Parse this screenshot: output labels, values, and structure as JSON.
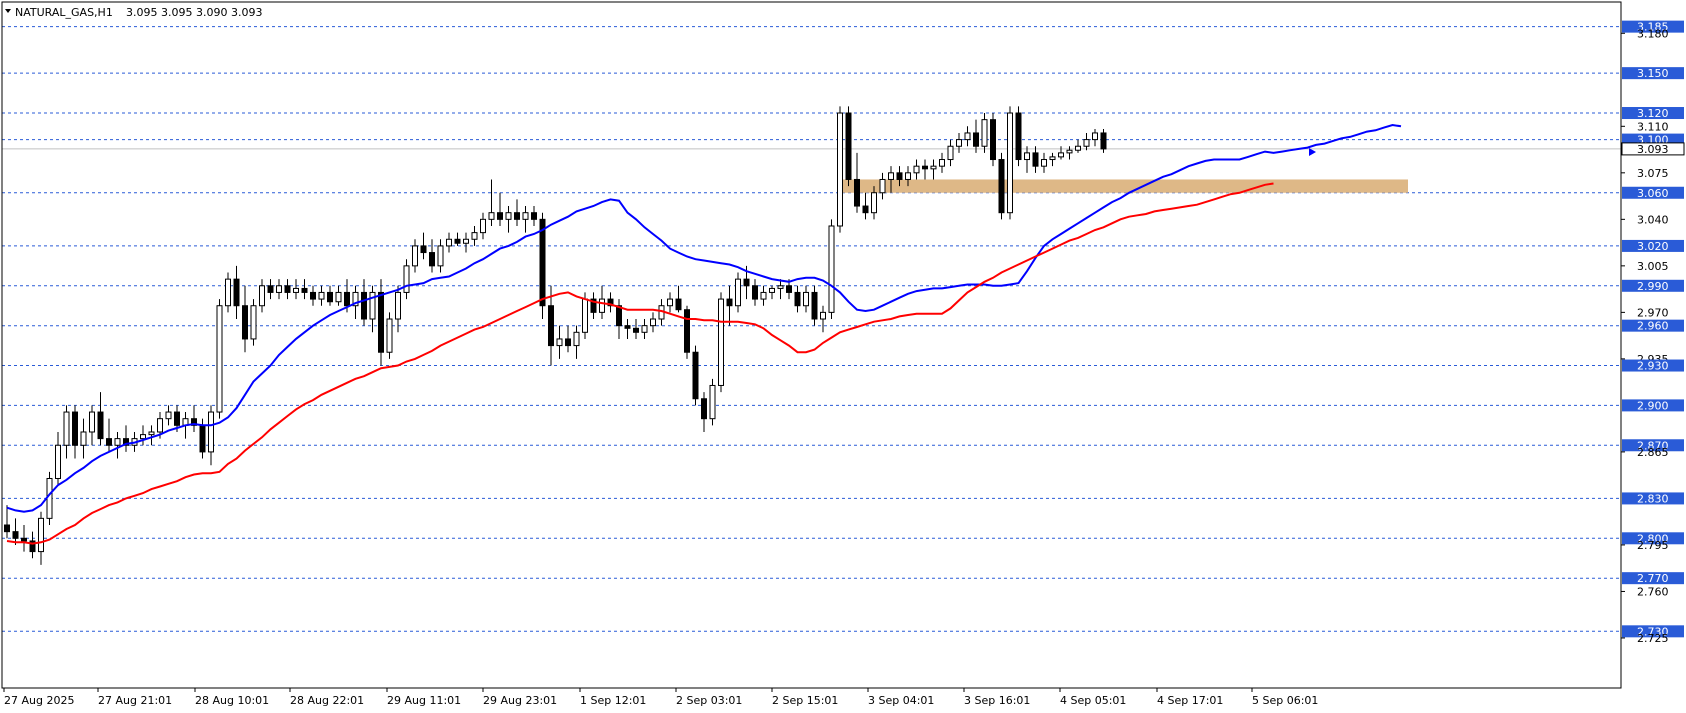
{
  "header": {
    "symbol": "NATURAL_GAS,H1",
    "ohlc": "3.095 3.095 3.090 3.093"
  },
  "chart_data": {
    "type": "candlestick",
    "title": "NATURAL_GAS,H1",
    "ylim": [
      2.715,
      3.195
    ],
    "grid": false,
    "y_ticks": [
      "3.185",
      "3.180",
      "3.150",
      "3.120",
      "3.110",
      "3.100",
      "3.093",
      "3.075",
      "3.060",
      "3.040",
      "3.020",
      "3.005",
      "2.990",
      "2.970",
      "2.960",
      "2.935",
      "2.930",
      "2.900",
      "2.870",
      "2.865",
      "2.830",
      "2.800",
      "2.795",
      "2.770",
      "2.760",
      "2.730",
      "2.725"
    ],
    "x_ticks": [
      "27 Aug 2025",
      "27 Aug 21:01",
      "28 Aug 10:01",
      "28 Aug 22:01",
      "29 Aug 11:01",
      "29 Aug 23:01",
      "1 Sep 12:01",
      "2 Sep 03:01",
      "2 Sep 15:01",
      "3 Sep 04:01",
      "3 Sep 16:01",
      "4 Sep 05:01",
      "4 Sep 17:01",
      "5 Sep 06:01"
    ],
    "levels": [
      3.185,
      3.15,
      3.12,
      3.1,
      3.06,
      3.02,
      2.99,
      2.96,
      2.93,
      2.9,
      2.87,
      2.83,
      2.8,
      2.77,
      2.73
    ],
    "current_price": 3.093,
    "zone": {
      "low": 3.06,
      "high": 3.07
    },
    "series": [
      {
        "name": "blue",
        "values": [
          2.823,
          2.821,
          2.82,
          2.821,
          2.825,
          2.833,
          2.84,
          2.844,
          2.849,
          2.853,
          2.858,
          2.862,
          2.865,
          2.868,
          2.871,
          2.872,
          2.874,
          2.876,
          2.878,
          2.881,
          2.883,
          2.885,
          2.886,
          2.885,
          2.885,
          2.887,
          2.891,
          2.898,
          2.908,
          2.918,
          2.924,
          2.93,
          2.938,
          2.944,
          2.95,
          2.955,
          2.96,
          2.964,
          2.968,
          2.971,
          2.974,
          2.977,
          2.979,
          2.981,
          2.983,
          2.985,
          2.987,
          2.99,
          2.991,
          2.992,
          2.995,
          2.996,
          2.997,
          3.0,
          3.003,
          3.007,
          3.01,
          3.014,
          3.018,
          3.02,
          3.023,
          3.027,
          3.029,
          3.032,
          3.036,
          3.039,
          3.042,
          3.046,
          3.048,
          3.05,
          3.053,
          3.055,
          3.054,
          3.045,
          3.04,
          3.034,
          3.029,
          3.024,
          3.018,
          3.015,
          3.012,
          3.01,
          3.009,
          3.008,
          3.007,
          3.006,
          3.004,
          3.001,
          2.999,
          2.997,
          2.995,
          2.994,
          2.993,
          2.995,
          2.996,
          2.996,
          2.994,
          2.99,
          2.985,
          2.978,
          2.972,
          2.971,
          2.972,
          2.975,
          2.978,
          2.981,
          2.984,
          2.986,
          2.987,
          2.988,
          2.988,
          2.989,
          2.99,
          2.991,
          2.991,
          2.991,
          2.99,
          2.99,
          2.991,
          2.992,
          3.001,
          3.011,
          3.02,
          3.025,
          3.029,
          3.033,
          3.037,
          3.041,
          3.045,
          3.049,
          3.053,
          3.056,
          3.06,
          3.063,
          3.066,
          3.069,
          3.072,
          3.074,
          3.077,
          3.08,
          3.082,
          3.084,
          3.085,
          3.085,
          3.085,
          3.085,
          3.087,
          3.089,
          3.091,
          3.09,
          3.091,
          3.092,
          3.093,
          3.094,
          3.096,
          3.097,
          3.099,
          3.101,
          3.102,
          3.104,
          3.106,
          3.107,
          3.109,
          3.111,
          3.11
        ]
      },
      {
        "name": "red",
        "values": [
          2.798,
          2.797,
          2.797,
          2.796,
          2.797,
          2.799,
          2.803,
          2.807,
          2.81,
          2.815,
          2.819,
          2.822,
          2.825,
          2.827,
          2.83,
          2.832,
          2.834,
          2.837,
          2.839,
          2.841,
          2.843,
          2.846,
          2.848,
          2.849,
          2.849,
          2.85,
          2.856,
          2.86,
          2.866,
          2.871,
          2.876,
          2.882,
          2.887,
          2.892,
          2.897,
          2.901,
          2.904,
          2.908,
          2.911,
          2.914,
          2.917,
          2.92,
          2.922,
          2.925,
          2.928,
          2.929,
          2.93,
          2.933,
          2.935,
          2.938,
          2.941,
          2.945,
          2.948,
          2.951,
          2.954,
          2.957,
          2.959,
          2.962,
          2.965,
          2.968,
          2.971,
          2.974,
          2.977,
          2.98,
          2.982,
          2.984,
          2.985,
          2.982,
          2.98,
          2.978,
          2.977,
          2.976,
          2.974,
          2.972,
          2.972,
          2.972,
          2.972,
          2.971,
          2.969,
          2.967,
          2.965,
          2.965,
          2.964,
          2.964,
          2.963,
          2.963,
          2.963,
          2.962,
          2.961,
          2.958,
          2.953,
          2.949,
          2.945,
          2.94,
          2.94,
          2.942,
          2.947,
          2.951,
          2.955,
          2.957,
          2.959,
          2.961,
          2.963,
          2.964,
          2.965,
          2.967,
          2.968,
          2.969,
          2.969,
          2.969,
          2.969,
          2.973,
          2.979,
          2.985,
          2.989,
          2.993,
          2.996,
          3.0,
          3.003,
          3.006,
          3.009,
          3.012,
          3.015,
          3.018,
          3.021,
          3.024,
          3.026,
          3.029,
          3.032,
          3.034,
          3.037,
          3.04,
          3.042,
          3.043,
          3.044,
          3.046,
          3.047,
          3.048,
          3.049,
          3.05,
          3.051,
          3.053,
          3.055,
          3.057,
          3.059,
          3.06,
          3.062,
          3.064,
          3.066,
          3.067
        ]
      }
    ],
    "candles": [
      [
        2.81,
        2.825,
        2.8,
        2.805
      ],
      [
        2.805,
        2.815,
        2.795,
        2.8
      ],
      [
        2.8,
        2.81,
        2.79,
        2.798
      ],
      [
        2.798,
        2.805,
        2.785,
        2.79
      ],
      [
        2.79,
        2.82,
        2.78,
        2.815
      ],
      [
        2.815,
        2.85,
        2.81,
        2.845
      ],
      [
        2.845,
        2.88,
        2.84,
        2.87
      ],
      [
        2.87,
        2.9,
        2.86,
        2.895
      ],
      [
        2.895,
        2.9,
        2.86,
        2.87
      ],
      [
        2.87,
        2.89,
        2.86,
        2.88
      ],
      [
        2.88,
        2.9,
        2.87,
        2.895
      ],
      [
        2.895,
        2.91,
        2.87,
        2.875
      ],
      [
        2.875,
        2.89,
        2.865,
        2.87
      ],
      [
        2.87,
        2.88,
        2.86,
        2.875
      ],
      [
        2.875,
        2.885,
        2.865,
        2.87
      ],
      [
        2.87,
        2.88,
        2.865,
        2.875
      ],
      [
        2.875,
        2.885,
        2.87,
        2.878
      ],
      [
        2.878,
        2.885,
        2.87,
        2.88
      ],
      [
        2.88,
        2.895,
        2.875,
        2.89
      ],
      [
        2.89,
        2.9,
        2.885,
        2.895
      ],
      [
        2.895,
        2.9,
        2.88,
        2.885
      ],
      [
        2.885,
        2.895,
        2.875,
        2.89
      ],
      [
        2.89,
        2.9,
        2.88,
        2.885
      ],
      [
        2.885,
        2.89,
        2.86,
        2.865
      ],
      [
        2.865,
        2.9,
        2.855,
        2.895
      ],
      [
        2.895,
        2.98,
        2.89,
        2.975
      ],
      [
        2.975,
        3.0,
        2.97,
        2.995
      ],
      [
        2.995,
        3.005,
        2.965,
        2.975
      ],
      [
        2.975,
        2.99,
        2.94,
        2.95
      ],
      [
        2.95,
        2.98,
        2.945,
        2.975
      ],
      [
        2.975,
        2.995,
        2.97,
        2.99
      ],
      [
        2.99,
        2.995,
        2.98,
        2.985
      ],
      [
        2.985,
        2.995,
        2.98,
        2.99
      ],
      [
        2.99,
        2.995,
        2.98,
        2.985
      ],
      [
        2.985,
        2.995,
        2.98,
        2.988
      ],
      [
        2.988,
        2.995,
        2.98,
        2.985
      ],
      [
        2.985,
        2.99,
        2.975,
        2.98
      ],
      [
        2.98,
        2.99,
        2.975,
        2.985
      ],
      [
        2.985,
        2.99,
        2.975,
        2.978
      ],
      [
        2.978,
        2.99,
        2.975,
        2.985
      ],
      [
        2.985,
        2.995,
        2.97,
        2.975
      ],
      [
        2.975,
        2.99,
        2.965,
        2.985
      ],
      [
        2.985,
        2.995,
        2.96,
        2.965
      ],
      [
        2.965,
        2.99,
        2.955,
        2.985
      ],
      [
        2.985,
        2.995,
        2.93,
        2.94
      ],
      [
        2.94,
        2.97,
        2.935,
        2.965
      ],
      [
        2.965,
        2.99,
        2.955,
        2.985
      ],
      [
        2.985,
        3.01,
        2.98,
        3.005
      ],
      [
        3.005,
        3.025,
        3.0,
        3.02
      ],
      [
        3.02,
        3.03,
        3.01,
        3.015
      ],
      [
        3.015,
        3.025,
        3.0,
        3.005
      ],
      [
        3.005,
        3.025,
        3.0,
        3.02
      ],
      [
        3.02,
        3.03,
        3.015,
        3.025
      ],
      [
        3.025,
        3.03,
        3.02,
        3.022
      ],
      [
        3.022,
        3.03,
        3.015,
        3.025
      ],
      [
        3.025,
        3.035,
        3.02,
        3.03
      ],
      [
        3.03,
        3.045,
        3.025,
        3.04
      ],
      [
        3.04,
        3.07,
        3.035,
        3.045
      ],
      [
        3.045,
        3.06,
        3.035,
        3.04
      ],
      [
        3.04,
        3.05,
        3.03,
        3.045
      ],
      [
        3.045,
        3.055,
        3.035,
        3.04
      ],
      [
        3.04,
        3.05,
        3.03,
        3.045
      ],
      [
        3.045,
        3.05,
        3.035,
        3.04
      ],
      [
        3.04,
        3.045,
        2.965,
        2.975
      ],
      [
        2.975,
        2.99,
        2.93,
        2.945
      ],
      [
        2.945,
        2.96,
        2.935,
        2.95
      ],
      [
        2.95,
        2.96,
        2.94,
        2.945
      ],
      [
        2.945,
        2.96,
        2.935,
        2.955
      ],
      [
        2.955,
        2.985,
        2.95,
        2.98
      ],
      [
        2.98,
        2.985,
        2.965,
        2.97
      ],
      [
        2.97,
        2.99,
        2.965,
        2.98
      ],
      [
        2.98,
        2.985,
        2.97,
        2.975
      ],
      [
        2.975,
        2.98,
        2.95,
        2.96
      ],
      [
        2.96,
        2.965,
        2.95,
        2.958
      ],
      [
        2.958,
        2.965,
        2.95,
        2.955
      ],
      [
        2.955,
        2.965,
        2.95,
        2.96
      ],
      [
        2.96,
        2.97,
        2.955,
        2.965
      ],
      [
        2.965,
        2.98,
        2.96,
        2.975
      ],
      [
        2.975,
        2.985,
        2.97,
        2.98
      ],
      [
        2.98,
        2.99,
        2.97,
        2.972
      ],
      [
        2.972,
        2.975,
        2.935,
        2.94
      ],
      [
        2.94,
        2.945,
        2.9,
        2.905
      ],
      [
        2.905,
        2.91,
        2.88,
        2.89
      ],
      [
        2.89,
        2.92,
        2.885,
        2.915
      ],
      [
        2.915,
        2.985,
        2.91,
        2.98
      ],
      [
        2.98,
        2.99,
        2.96,
        2.975
      ],
      [
        2.975,
        3.0,
        2.97,
        2.995
      ],
      [
        2.995,
        3.005,
        2.98,
        2.99
      ],
      [
        2.99,
        2.995,
        2.975,
        2.98
      ],
      [
        2.98,
        2.99,
        2.975,
        2.985
      ],
      [
        2.985,
        2.99,
        2.98,
        2.988
      ],
      [
        2.988,
        2.995,
        2.98,
        2.99
      ],
      [
        2.99,
        2.995,
        2.98,
        2.985
      ],
      [
        2.985,
        2.99,
        2.97,
        2.975
      ],
      [
        2.975,
        2.99,
        2.97,
        2.985
      ],
      [
        2.985,
        2.99,
        2.96,
        2.965
      ],
      [
        2.965,
        2.975,
        2.955,
        2.97
      ],
      [
        2.97,
        3.04,
        2.965,
        3.035
      ],
      [
        3.035,
        3.125,
        3.03,
        3.12
      ],
      [
        3.12,
        3.125,
        3.065,
        3.07
      ],
      [
        3.07,
        3.09,
        3.045,
        3.05
      ],
      [
        3.05,
        3.06,
        3.04,
        3.045
      ],
      [
        3.045,
        3.065,
        3.04,
        3.06
      ],
      [
        3.06,
        3.075,
        3.055,
        3.07
      ],
      [
        3.07,
        3.08,
        3.06,
        3.075
      ],
      [
        3.075,
        3.08,
        3.065,
        3.07
      ],
      [
        3.07,
        3.08,
        3.065,
        3.075
      ],
      [
        3.075,
        3.085,
        3.07,
        3.08
      ],
      [
        3.08,
        3.085,
        3.07,
        3.078
      ],
      [
        3.078,
        3.085,
        3.07,
        3.08
      ],
      [
        3.08,
        3.09,
        3.075,
        3.085
      ],
      [
        3.085,
        3.1,
        3.08,
        3.095
      ],
      [
        3.095,
        3.105,
        3.09,
        3.1
      ],
      [
        3.1,
        3.11,
        3.095,
        3.105
      ],
      [
        3.105,
        3.115,
        3.09,
        3.095
      ],
      [
        3.095,
        3.12,
        3.09,
        3.115
      ],
      [
        3.115,
        3.12,
        3.08,
        3.085
      ],
      [
        3.085,
        3.09,
        3.04,
        3.045
      ],
      [
        3.045,
        3.125,
        3.04,
        3.12
      ],
      [
        3.12,
        3.125,
        3.08,
        3.085
      ],
      [
        3.085,
        3.095,
        3.075,
        3.09
      ],
      [
        3.09,
        3.095,
        3.075,
        3.08
      ],
      [
        3.08,
        3.09,
        3.075,
        3.085
      ],
      [
        3.085,
        3.09,
        3.08,
        3.087
      ],
      [
        3.087,
        3.095,
        3.085,
        3.09
      ],
      [
        3.09,
        3.095,
        3.085,
        3.092
      ],
      [
        3.092,
        3.1,
        3.09,
        3.095
      ],
      [
        3.095,
        3.105,
        3.092,
        3.1
      ],
      [
        3.1,
        3.108,
        3.095,
        3.105
      ],
      [
        3.105,
        3.108,
        3.09,
        3.093
      ]
    ]
  }
}
